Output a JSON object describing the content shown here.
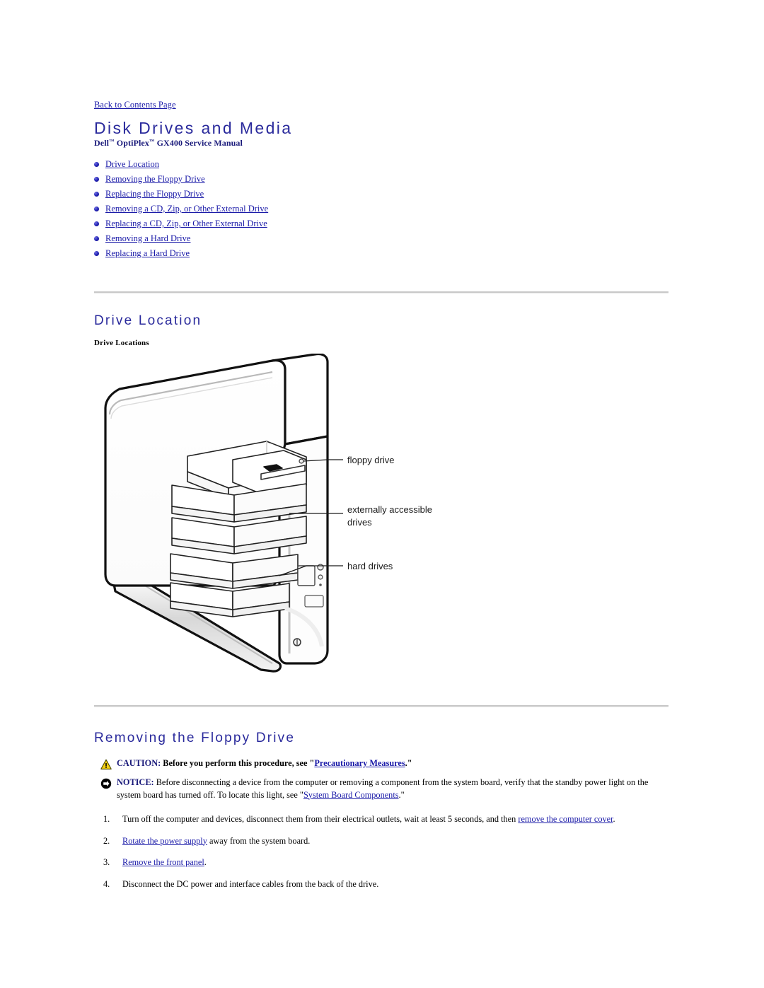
{
  "document": {
    "back_link": "Back to Contents Page",
    "title": "Disk Drives and Media",
    "subtitle_prefix": "Dell",
    "subtitle_tm1": "™",
    "subtitle_mid": " OptiPlex",
    "subtitle_tm2": "™",
    "subtitle_suffix": " GX400 Service Manual"
  },
  "toc": {
    "items": [
      {
        "label": "Drive Location"
      },
      {
        "label": "Removing the Floppy Drive"
      },
      {
        "label": "Replacing the Floppy Drive"
      },
      {
        "label": "Removing a CD, Zip, or Other External Drive"
      },
      {
        "label": "Replacing a CD, Zip, or Other External Drive"
      },
      {
        "label": "Removing a Hard Drive"
      },
      {
        "label": "Replacing a Hard Drive"
      }
    ]
  },
  "drive_location": {
    "heading": "Drive Location",
    "figure_caption": "Drive Locations",
    "callouts": {
      "floppy": "floppy drive",
      "external_line1": "externally accessible",
      "external_line2": "drives",
      "hard": "hard drives"
    }
  },
  "removing_floppy": {
    "heading": "Removing the Floppy Drive",
    "caution": {
      "keyword": "CAUTION:",
      "text_before": " Before you perform this procedure, see \"",
      "link": "Precautionary Measures",
      "text_after": ".\""
    },
    "notice": {
      "keyword": "NOTICE:",
      "text_before": " Before disconnecting a device from the computer or removing a component from the system board, verify that the standby power light on the system board has turned off. To locate this light, see \"",
      "link": "System Board Components",
      "text_after": ".\""
    },
    "steps": [
      {
        "number": "1.",
        "text_before": "Turn off the computer and devices, disconnect them from their electrical outlets, wait at least 5 seconds, and then ",
        "link": "remove the computer cover",
        "text_after": "."
      },
      {
        "number": "2.",
        "text_before": "",
        "link": "Rotate the power supply",
        "text_after": " away from the system board."
      },
      {
        "number": "3.",
        "text_before": "",
        "link": "Remove the front panel",
        "text_after": "."
      },
      {
        "number": "4.",
        "text_before": "Disconnect the DC power and interface cables from the back of the drive.",
        "link": "",
        "text_after": ""
      }
    ]
  },
  "colors": {
    "heading_blue": "#2a2a9c",
    "link_blue": "#1a1aa8",
    "rule_gray": "#c8c8c8",
    "caution_yellow": "#f5d010",
    "notice_black": "#000000"
  }
}
